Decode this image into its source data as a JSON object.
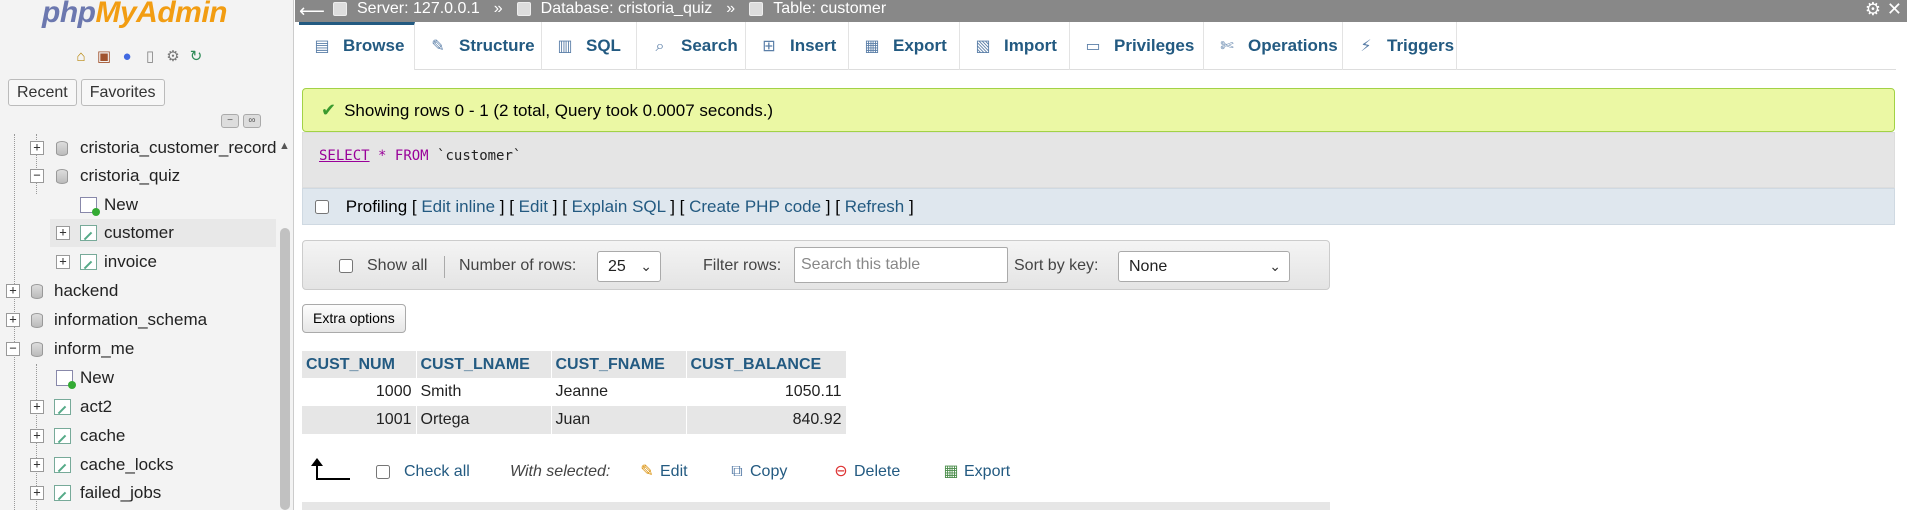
{
  "nav": {
    "logo_php": "php",
    "logo_myadmin": "MyAdmin",
    "icons": [
      "home-icon",
      "exit-icon",
      "help-icon",
      "docs-icon",
      "settings-icon",
      "reload-icon"
    ],
    "recent_label": "Recent",
    "favorites_label": "Favorites",
    "tree": [
      {
        "label": "cristoria_customer_records",
        "kind": "db",
        "level": 1,
        "expander": "+"
      },
      {
        "label": "cristoria_quiz",
        "kind": "db",
        "level": 1,
        "expander": "−"
      },
      {
        "label": "New",
        "kind": "new",
        "level": 2
      },
      {
        "label": "customer",
        "kind": "table",
        "level": 2,
        "expander": "+",
        "highlight": true
      },
      {
        "label": "invoice",
        "kind": "table",
        "level": 2,
        "expander": "+"
      },
      {
        "label": "hackend",
        "kind": "db",
        "level": 0,
        "expander": "+"
      },
      {
        "label": "information_schema",
        "kind": "db",
        "level": 0,
        "expander": "+"
      },
      {
        "label": "inform_me",
        "kind": "db",
        "level": 0,
        "expander": "−"
      },
      {
        "label": "New",
        "kind": "new",
        "level": 1
      },
      {
        "label": "act2",
        "kind": "table",
        "level": 1,
        "expander": "+"
      },
      {
        "label": "cache",
        "kind": "table",
        "level": 1,
        "expander": "+"
      },
      {
        "label": "cache_locks",
        "kind": "table",
        "level": 1,
        "expander": "+"
      },
      {
        "label": "failed_jobs",
        "kind": "table",
        "level": 1,
        "expander": "+"
      }
    ]
  },
  "breadcrumb": {
    "server": "Server: 127.0.0.1",
    "database": "Database: cristoria_quiz",
    "table": "Table: customer",
    "separator": "»"
  },
  "menu": [
    {
      "label": "Browse",
      "icon": "browse-icon",
      "active": true
    },
    {
      "label": "Structure",
      "icon": "structure-icon"
    },
    {
      "label": "SQL",
      "icon": "sql-icon"
    },
    {
      "label": "Search",
      "icon": "search-icon"
    },
    {
      "label": "Insert",
      "icon": "insert-icon"
    },
    {
      "label": "Export",
      "icon": "export-icon"
    },
    {
      "label": "Import",
      "icon": "import-icon"
    },
    {
      "label": "Privileges",
      "icon": "privileges-icon"
    },
    {
      "label": "Operations",
      "icon": "operations-icon"
    },
    {
      "label": "Triggers",
      "icon": "triggers-icon"
    }
  ],
  "message": {
    "text": "Showing rows 0 - 1 (2 total, Query took 0.0007 seconds.)"
  },
  "sql": {
    "select": "SELECT",
    "star": "*",
    "from": "FROM",
    "table": "`customer`"
  },
  "profiling": {
    "label": "Profiling",
    "edit_inline": "Edit inline",
    "edit": "Edit",
    "explain": "Explain SQL",
    "create_php": "Create PHP code",
    "refresh": "Refresh"
  },
  "controls": {
    "show_all": "Show all",
    "num_rows_label": "Number of rows:",
    "num_rows_value": "25",
    "filter_label": "Filter rows:",
    "filter_placeholder": "Search this table",
    "sort_label": "Sort by key:",
    "sort_value": "None",
    "extra_options": "Extra options"
  },
  "table": {
    "columns": [
      "CUST_NUM",
      "CUST_LNAME",
      "CUST_FNAME",
      "CUST_BALANCE"
    ],
    "rows": [
      [
        "1000",
        "Smith",
        "Jeanne",
        "1050.11"
      ],
      [
        "1001",
        "Ortega",
        "Juan",
        "840.92"
      ]
    ]
  },
  "bulk": {
    "check_all": "Check all",
    "with_selected": "With selected:",
    "edit": "Edit",
    "copy": "Copy",
    "delete": "Delete",
    "export": "Export"
  },
  "colors": {
    "accent": "#235a81",
    "success_bg": "#ebf8a4",
    "logo_orange": "#f29d12",
    "logo_blue": "#6c78af"
  }
}
